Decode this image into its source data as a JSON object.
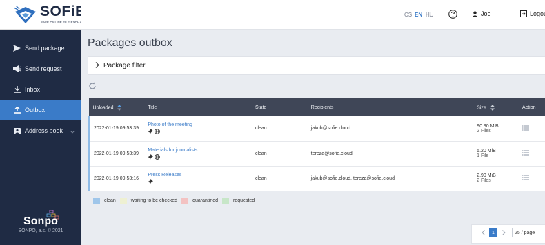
{
  "brand": {
    "logo_text": "SOFiE",
    "logo_subtitle": "SAFE ONLINE FILE EXCHANGE",
    "vendor": "Sonpo",
    "copyright": "SONPO, a.s. © 2021"
  },
  "sidebar": {
    "items": [
      {
        "label": "Send package",
        "icon": "send-icon"
      },
      {
        "label": "Send request",
        "icon": "megaphone-icon"
      },
      {
        "label": "Inbox",
        "icon": "download-icon"
      },
      {
        "label": "Outbox",
        "icon": "upload-icon",
        "active": true
      },
      {
        "label": "Address book",
        "icon": "address-book-icon",
        "has_submenu": true
      }
    ]
  },
  "topbar": {
    "languages": [
      "CS",
      "EN",
      "HU"
    ],
    "active_language": "EN",
    "user": "Joe",
    "logout_label": "Logout"
  },
  "main": {
    "title": "Packages outbox",
    "filter_label": "Package filter",
    "table": {
      "columns": [
        "Uploaded",
        "Title",
        "State",
        "Recipients",
        "Size",
        "Action"
      ],
      "rows": [
        {
          "uploaded": "2022-01-19 09:53:39",
          "title": "Photo of the meeting",
          "tags": [
            "pin-icon",
            "globe-icon"
          ],
          "state": "clean",
          "recipients": "jakub@sofie.cloud",
          "size": "90.90 MiB",
          "files": "2 Files"
        },
        {
          "uploaded": "2022-01-19 09:53:39",
          "title": "Materials for journalists",
          "tags": [
            "pin-icon",
            "globe-icon"
          ],
          "state": "clean",
          "recipients": "tereza@sofie.cloud",
          "size": "5.20 MiB",
          "files": "1 File"
        },
        {
          "uploaded": "2022-01-19 09:53:16",
          "title": "Press Releases",
          "tags": [
            "pin-icon"
          ],
          "state": "clean",
          "recipients": "jakub@sofie.cloud, tereza@sofie.cloud",
          "size": "2.90 MiB",
          "files": "2 Files"
        }
      ]
    },
    "legend": [
      {
        "label": "clean",
        "color": "#9fc6ea"
      },
      {
        "label": "waiting to be checked",
        "color": "#eef0d2"
      },
      {
        "label": "quarantined",
        "color": "#f3c2c2"
      },
      {
        "label": "requested",
        "color": "#c7e6c8"
      }
    ],
    "pagination": {
      "current_page": "1",
      "page_size": "25 / page"
    }
  },
  "colors": {
    "sidebar_bg": "#1f2b44",
    "accent": "#3a7bc8",
    "table_header_bg": "#3f4657"
  }
}
